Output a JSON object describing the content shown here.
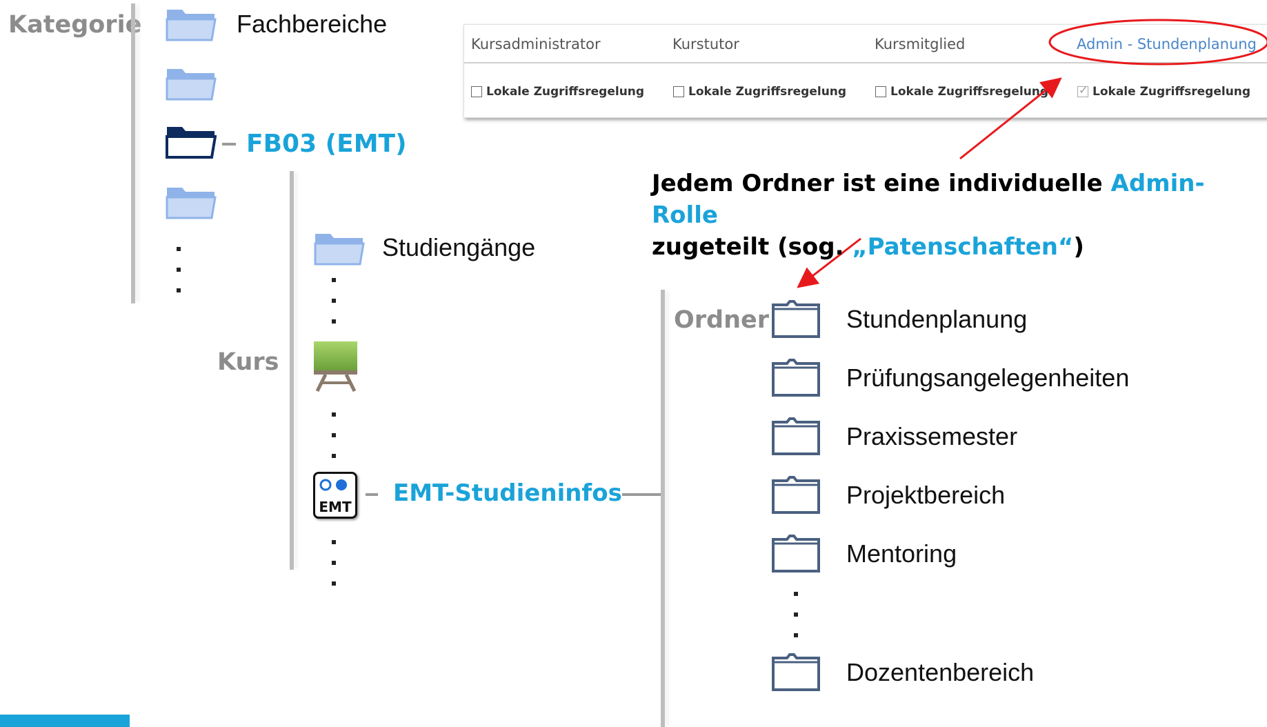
{
  "labels": {
    "kategorie": "Kategorie",
    "kurs": "Kurs",
    "ordner": "Ordner"
  },
  "category_tree": {
    "item_fachbereiche": "Fachbereiche",
    "item_fb03": "FB03 (EMT)",
    "item_studiengaenge": "Studiengänge",
    "item_emt_course": "EMT-Studieninfos",
    "emt_icon_text": "EMT"
  },
  "folders": [
    "Stundenplanung",
    "Prüfungsangelegenheiten",
    "Praxissemester",
    "Projektbereich",
    "Mentoring",
    "Dozentenbereich"
  ],
  "roles_panel": {
    "columns": [
      "Kursadministrator",
      "Kurstutor",
      "Kursmitglied",
      "Admin - Stundenplanung"
    ],
    "checkbox_label": "Lokale Zugriffsregelung",
    "checked": [
      false,
      false,
      false,
      true
    ]
  },
  "annotation": {
    "line1_prefix": "Jedem Ordner ist eine individuelle ",
    "line1_highlight": "Admin-Rolle",
    "line2_prefix": "zugeteilt (sog. ",
    "line2_highlight": "„Patenschaften“",
    "line2_suffix": ")"
  },
  "colors": {
    "accent": "#1aa3d9",
    "arrow": "#e8191c",
    "folder_light": "#8fb3e8",
    "folder_dark": "#0d2b5e",
    "folder_outline": "#4a6080"
  }
}
